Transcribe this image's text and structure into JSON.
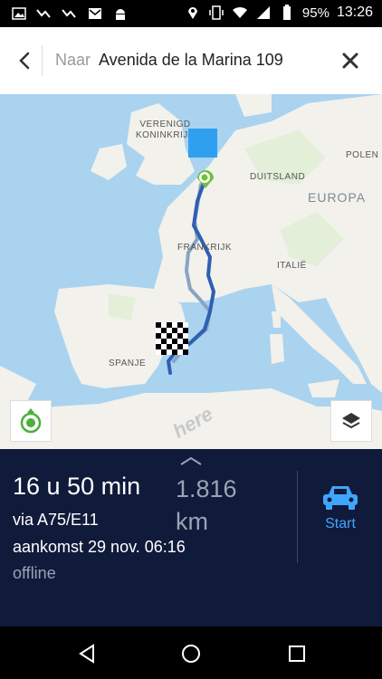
{
  "status_bar": {
    "battery": "95%",
    "time": "13:26"
  },
  "search": {
    "prefix": "Naar",
    "destination": "Avenida de la Marina 109"
  },
  "map": {
    "labels": {
      "uk": "VERENIGD\nKONINKRIJK",
      "poland": "POLEN",
      "germany": "DUITSLAND",
      "europe": "EUROPA",
      "france": "FRANKRIJK",
      "italy": "ITALIË",
      "spain": "SPANJE"
    },
    "watermark": "here"
  },
  "route": {
    "duration": "16 u 50 min",
    "distance": "1.816 km",
    "via": "via A75/E11",
    "arrival": "aankomst 29 nov. 06:16",
    "status": "offline",
    "start_label": "Start"
  },
  "colors": {
    "panel": "#101a3a",
    "accent": "#3fa6ff",
    "route": "#2f5fb3"
  }
}
